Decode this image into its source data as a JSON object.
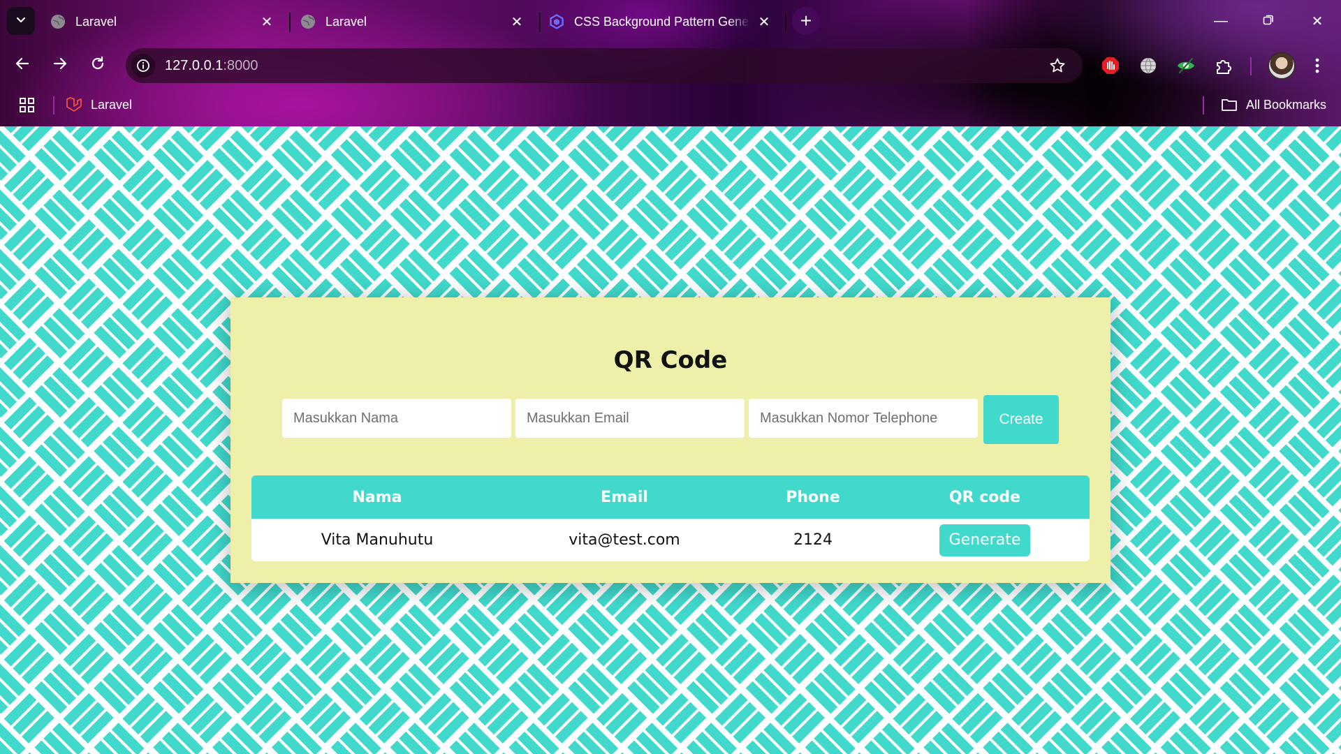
{
  "browser": {
    "tabs": [
      {
        "title": "Laravel",
        "icon": "globe-icon",
        "active": false
      },
      {
        "title": "Laravel",
        "icon": "globe-icon",
        "active": false
      },
      {
        "title": "CSS Background Pattern Genera",
        "icon": "hexagon-logo-icon",
        "active": true
      }
    ],
    "url_host": "127.0.0.1",
    "url_port": ":8000",
    "bookmarks": [
      {
        "title": "Laravel",
        "icon": "laravel-logo-icon"
      }
    ],
    "all_bookmarks_label": "All Bookmarks"
  },
  "page": {
    "title": "QR Code",
    "form": {
      "name_placeholder": "Masukkan Nama",
      "email_placeholder": "Masukkan Email",
      "phone_placeholder": "Masukkan Nomor Telephone",
      "create_label": "Create"
    },
    "table": {
      "headers": [
        "Nama",
        "Email",
        "Phone",
        "QR code"
      ],
      "rows": [
        {
          "nama": "Vita Manuhutu",
          "email": "vita@test.com",
          "phone": "2124",
          "action_label": "Generate"
        }
      ]
    }
  },
  "colors": {
    "accent": "#40d9cc",
    "card_background": "#eef0a9"
  }
}
